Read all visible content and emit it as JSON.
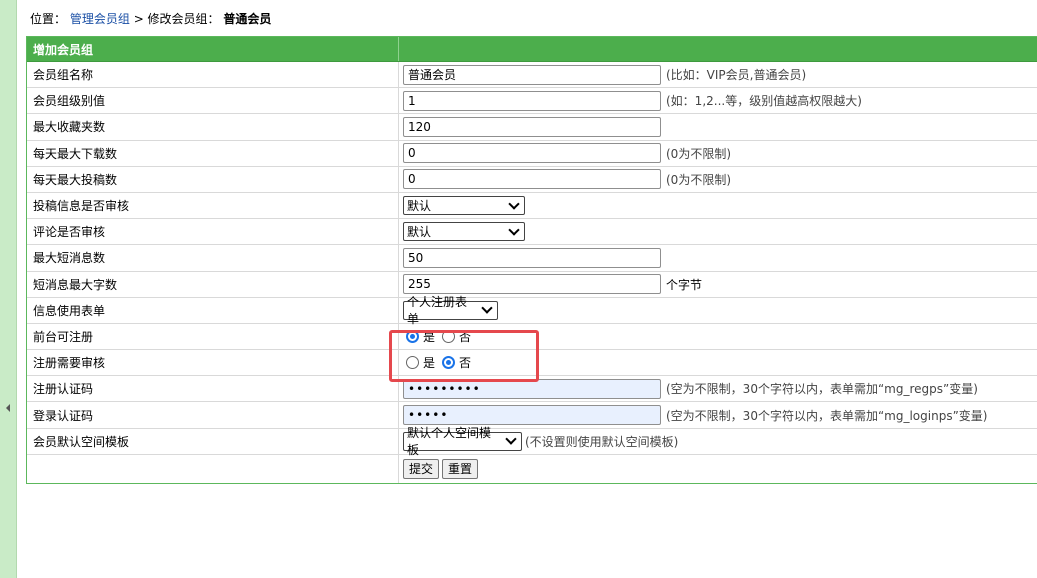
{
  "breadcrumb": {
    "prefix": "位置：",
    "link": "管理会员组",
    "sep": " > 修改会员组：",
    "current": "普通会员"
  },
  "form": {
    "header": "增加会员组",
    "group_name": {
      "label": "会员组名称",
      "value": "普通会员",
      "hint": "(比如：VIP会员,普通会员)"
    },
    "group_level": {
      "label": "会员组级别值",
      "value": "1",
      "hint": "(如：1,2...等，级别值越高权限越大)"
    },
    "max_favorites": {
      "label": "最大收藏夹数",
      "value": "120"
    },
    "max_downloads": {
      "label": "每天最大下载数",
      "value": "0",
      "hint": "(0为不限制)"
    },
    "max_submissions": {
      "label": "每天最大投稿数",
      "value": "0",
      "hint": "(0为不限制)"
    },
    "submission_review": {
      "label": "投稿信息是否审核",
      "value": "默认"
    },
    "comment_review": {
      "label": "评论是否审核",
      "value": "默认"
    },
    "max_messages": {
      "label": "最大短消息数",
      "value": "50"
    },
    "message_max_chars": {
      "label": "短消息最大字数",
      "value": "255",
      "unit": "个字节"
    },
    "info_form": {
      "label": "信息使用表单",
      "value": "个人注册表单"
    },
    "front_register": {
      "label": "前台可注册",
      "yes": "是",
      "no": "否",
      "selected": "yes"
    },
    "register_review": {
      "label": "注册需要审核",
      "yes": "是",
      "no": "否",
      "selected": "no"
    },
    "reg_code": {
      "label": "注册认证码",
      "value": "•••••••••",
      "hint": "(空为不限制，30个字符以内，表单需加“mg_regps”变量)"
    },
    "login_code": {
      "label": "登录认证码",
      "value": "•••••",
      "hint": "(空为不限制，30个字符以内，表单需加“mg_loginps”变量)"
    },
    "space_template": {
      "label": "会员默认空间模板",
      "value": "默认个人空间模板",
      "hint": "(不设置则使用默认空间模板)"
    },
    "submit_label": "提交",
    "reset_label": "重置"
  },
  "colors": {
    "header_green": "#4cae4c",
    "side_rail": "#c9ebc7",
    "highlight": "#e5484d",
    "radio_on": "#1a73e8"
  }
}
